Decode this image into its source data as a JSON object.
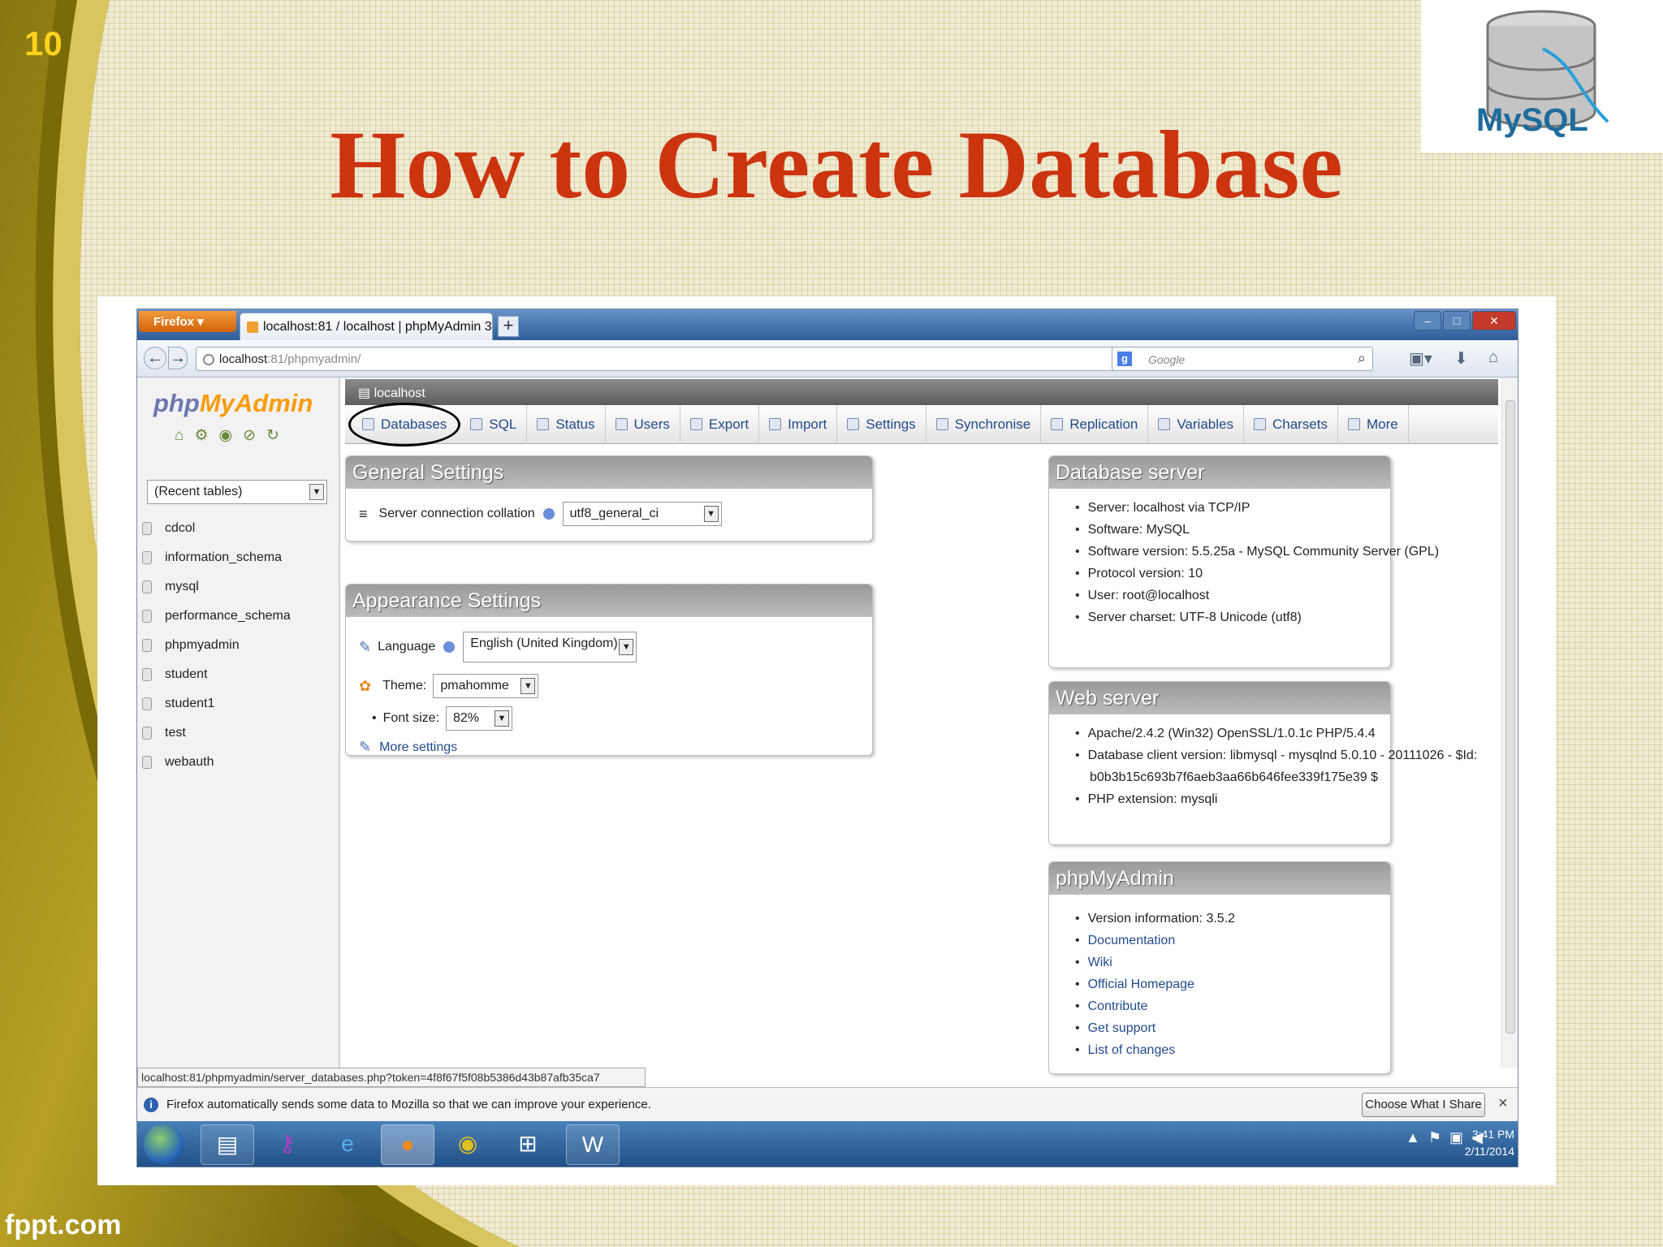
{
  "slide": {
    "number": "10",
    "title": "How to Create Database",
    "brand": "fppt.com",
    "logo_text": "MySQL"
  },
  "browser": {
    "menu_button": "Firefox",
    "tab_title": "localhost:81 / localhost | phpMyAdmin 3....",
    "new_tab": "+",
    "url_host": "localhost",
    "url_rest": ":81/phpmyadmin/",
    "search_placeholder": "Google",
    "search_engine": "g"
  },
  "pma": {
    "logo_php": "php",
    "logo_myadmin": "MyAdmin",
    "recent_tables": "(Recent tables)",
    "databases": [
      "cdcol",
      "information_schema",
      "mysql",
      "performance_schema",
      "phpmyadmin",
      "student",
      "student1",
      "test",
      "webauth"
    ],
    "breadcrumb": "localhost",
    "menu": [
      {
        "label": "Databases",
        "active": true
      },
      {
        "label": "SQL"
      },
      {
        "label": "Status"
      },
      {
        "label": "Users"
      },
      {
        "label": "Export"
      },
      {
        "label": "Import"
      },
      {
        "label": "Settings"
      },
      {
        "label": "Synchronise"
      },
      {
        "label": "Replication"
      },
      {
        "label": "Variables"
      },
      {
        "label": "Charsets"
      },
      {
        "label": "More"
      }
    ],
    "general": {
      "title": "General Settings",
      "collation_label": "Server connection collation",
      "collation_value": "utf8_general_ci"
    },
    "appearance": {
      "title": "Appearance Settings",
      "language_label": "Language",
      "language_value": "English (United Kingdom)",
      "theme_label": "Theme:",
      "theme_value": "pmahomme",
      "fontsize_label": "Font size:",
      "fontsize_value": "82%",
      "more_settings": "More settings"
    },
    "db_server": {
      "title": "Database server",
      "items": [
        "Server: localhost via TCP/IP",
        "Software: MySQL",
        "Software version: 5.5.25a - MySQL Community Server (GPL)",
        "Protocol version: 10",
        "User: root@localhost",
        "Server charset: UTF-8 Unicode (utf8)"
      ]
    },
    "web_server": {
      "title": "Web server",
      "items": [
        "Apache/2.4.2 (Win32) OpenSSL/1.0.1c PHP/5.4.4",
        "Database client version: libmysql - mysqlnd 5.0.10 - 20111026 - $Id:",
        "b0b3b15c693b7f6aeb3aa66b646fee339f175e39 $",
        "PHP extension: mysqli"
      ]
    },
    "pma_panel": {
      "title": "phpMyAdmin",
      "items": [
        "Version information: 3.5.2",
        "Documentation",
        "Wiki",
        "Official Homepage",
        "Contribute",
        "Get support",
        "List of changes"
      ]
    }
  },
  "status_url": "localhost:81/phpmyadmin/server_databases.php?token=4f8f67f5f08b5386d43b87afb35ca7",
  "notification": {
    "message": "Firefox automatically sends some data to Mozilla so that we can improve your experience.",
    "button": "Choose What I Share",
    "close": "×"
  },
  "taskbar": {
    "time": "3:41 PM",
    "date": "2/11/2014"
  },
  "colors": {
    "title": "#cc3410",
    "slide_number": "#ffd21e",
    "pma_blue": "#6c78af",
    "pma_orange": "#f89c0e"
  }
}
